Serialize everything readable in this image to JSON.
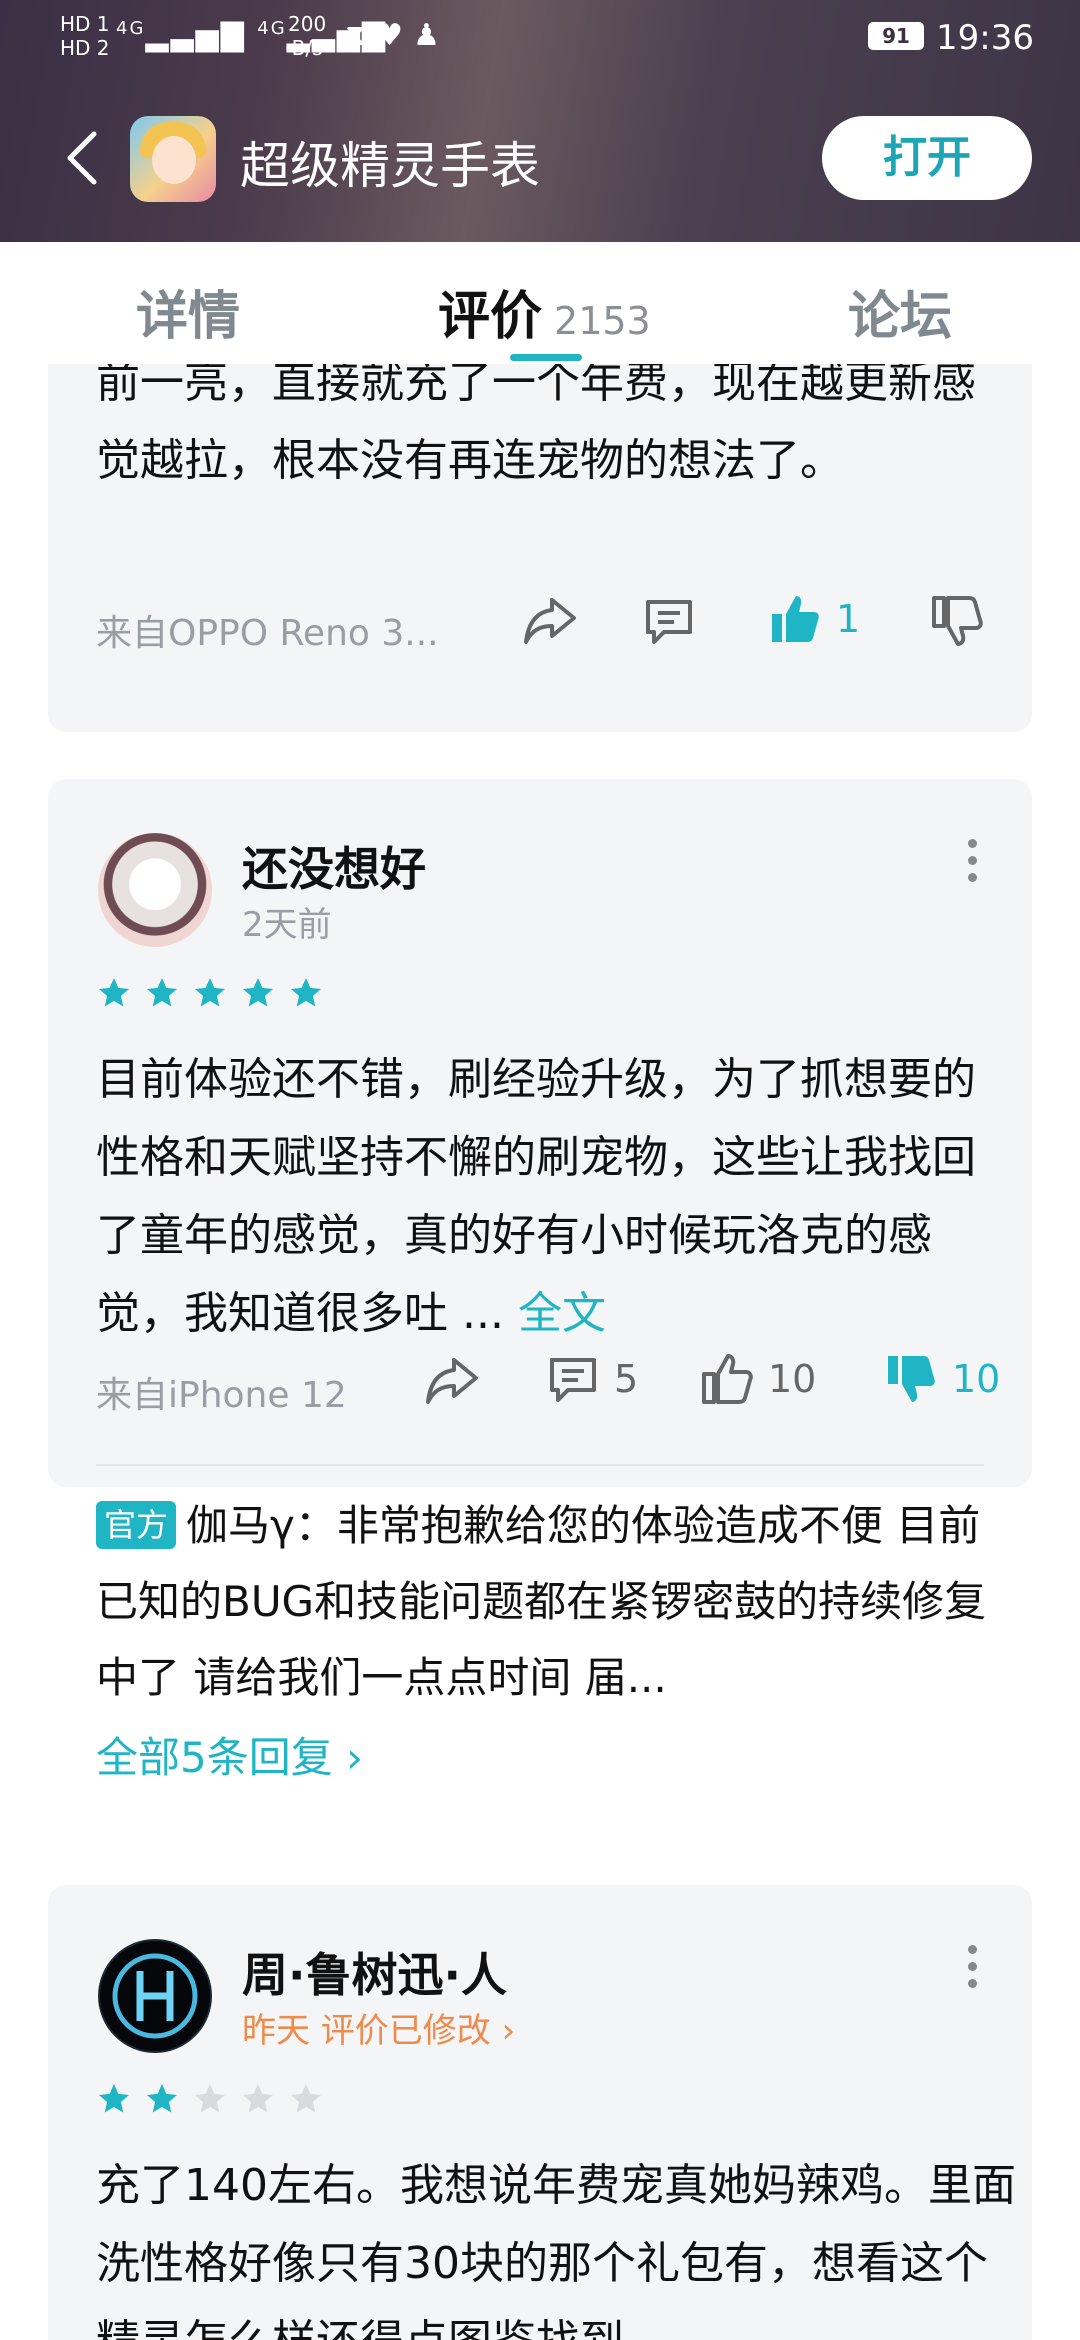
{
  "status_bar": {
    "sim1": "HD 1",
    "sim2": "HD 2",
    "signal1": "4G",
    "signal2": "4G",
    "net_speed": "200",
    "net_unit": "B/s",
    "battery": "91",
    "time": "19:36"
  },
  "app_bar": {
    "title": "超级精灵手表",
    "open_label": "打开"
  },
  "tabs": {
    "details": "详情",
    "reviews": "评价",
    "reviews_count": "2153",
    "forum": "论坛"
  },
  "review_prev": {
    "text": "前一亮，直接就充了一个年费，现在越更新感觉越拉，根本没有再连宠物的想法了。",
    "source": "来自OPPO Reno 3...",
    "likes": "1"
  },
  "review_1": {
    "username": "还没想好",
    "time": "2天前",
    "rating": 5,
    "text": "目前体验还不错，刷经验升级，为了抓想要的性格和天赋坚持不懈的刷宠物，这些让我找回了童年的感觉，真的好有小时候玩洛克的感觉，我知道很多吐 ...",
    "full_text_link": "全文",
    "source": "来自iPhone 12",
    "comments": "5",
    "likes": "10",
    "dislikes": "10",
    "official_badge": "官方",
    "reply_author": "伽马γ",
    "reply_text": "：非常抱歉给您的体验造成不便 目前已知的BUG和技能问题都在紧锣密鼓的持续修复中了 请给我们一点点时间 届...",
    "all_replies": "全部5条回复"
  },
  "review_2": {
    "username": "周·鲁树迅·人",
    "time_meta": "昨天 评价已修改",
    "rating": 2,
    "text": "充了140左右。我想说年费宠真她妈辣鸡。里面洗性格好像只有30块的那个礼包有，想看这个精灵怎么样还得点图鉴找到"
  },
  "colors": {
    "accent": "#1fb5c4",
    "modified": "#f08a4b",
    "card_bg": "#f4f5f7"
  }
}
